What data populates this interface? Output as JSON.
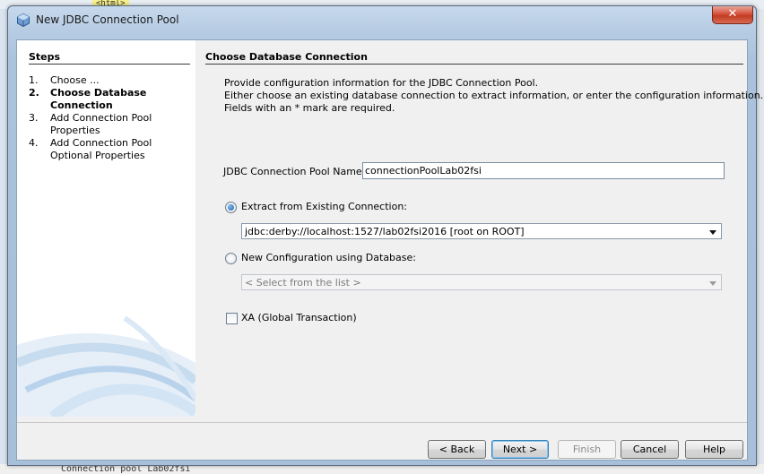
{
  "background": {
    "code_snippet": "<html>",
    "bottom_text": "Connection pool  Lab02fsi"
  },
  "window": {
    "title": "New JDBC Connection Pool",
    "close_label": "✕"
  },
  "steps": {
    "heading": "Steps",
    "items": [
      {
        "num": "1.",
        "label": "Choose ..."
      },
      {
        "num": "2.",
        "label": "Choose Database Connection"
      },
      {
        "num": "3.",
        "label": "Add Connection Pool Properties"
      },
      {
        "num": "4.",
        "label": "Add Connection Pool Optional Properties"
      }
    ]
  },
  "panel": {
    "heading": "Choose Database Connection",
    "description": [
      "Provide configuration information for the JDBC Connection Pool.",
      "Either choose an existing database connection to extract information, or enter the configuration information.",
      "Fields with an * mark are required."
    ],
    "pool_name_label": "JDBC Connection Pool Name:*",
    "pool_name_value": "connectionPoolLab02fsi",
    "extract_option_label": "Extract from Existing Connection:",
    "extract_option_selected": true,
    "connection_value": "jdbc:derby://localhost:1527/lab02fsi2016 [root on ROOT]",
    "new_config_label": "New Configuration using Database:",
    "new_config_selected": false,
    "database_placeholder": "< Select from the list >",
    "xa_label": "XA (Global Transaction)",
    "xa_checked": false
  },
  "buttons": {
    "back": "< Back",
    "next": "Next >",
    "finish": "Finish",
    "cancel": "Cancel",
    "help": "Help"
  },
  "colors": {
    "title_bar": "#b5cbe3",
    "close_button": "#c23b22",
    "default_button_border": "#3c7fb1"
  }
}
